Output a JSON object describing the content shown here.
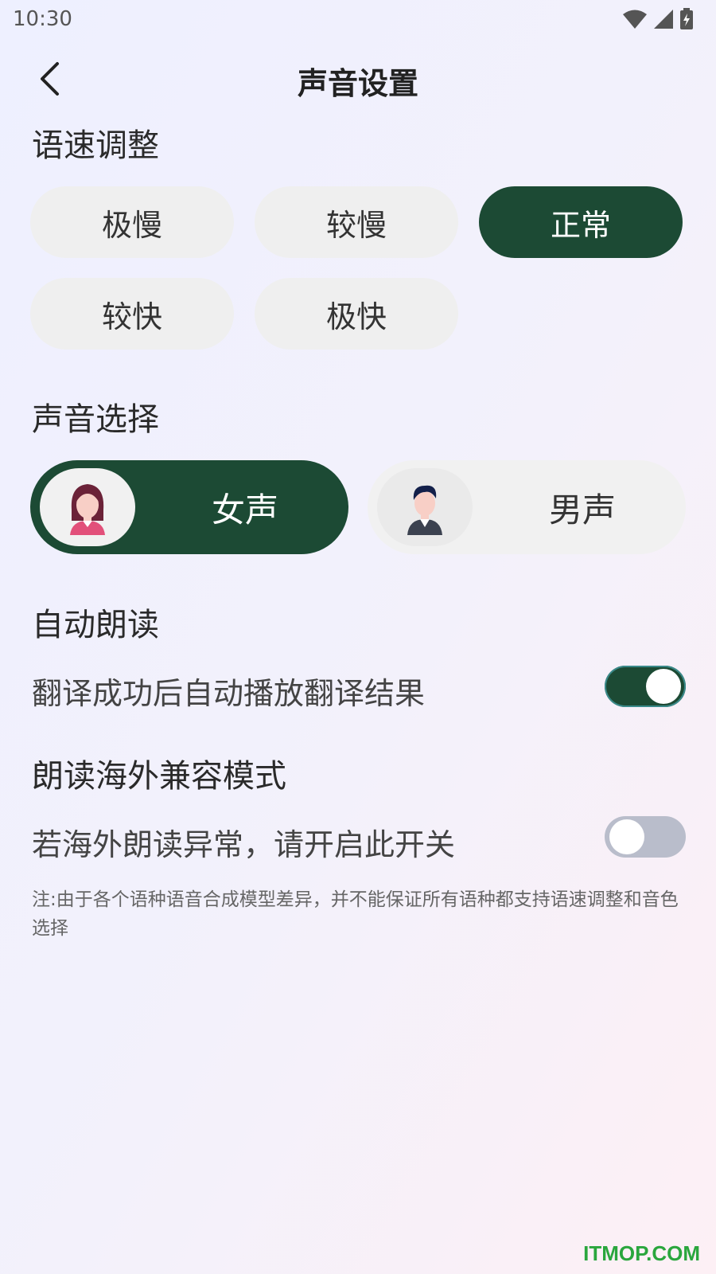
{
  "status_bar": {
    "time": "10:30"
  },
  "header": {
    "title": "声音设置"
  },
  "speed": {
    "title": "语速调整",
    "options": [
      {
        "label": "极慢",
        "selected": false
      },
      {
        "label": "较慢",
        "selected": false
      },
      {
        "label": "正常",
        "selected": true
      },
      {
        "label": "较快",
        "selected": false
      },
      {
        "label": "极快",
        "selected": false
      }
    ]
  },
  "voice": {
    "title": "声音选择",
    "options": [
      {
        "label": "女声",
        "selected": true
      },
      {
        "label": "男声",
        "selected": false
      }
    ]
  },
  "auto_read": {
    "title": "自动朗读",
    "description": "翻译成功后自动播放翻译结果",
    "enabled": true
  },
  "compat_mode": {
    "title": "朗读海外兼容模式",
    "description": "若海外朗读异常，请开启此开关",
    "enabled": false
  },
  "note": "注:由于各个语种语音合成模型差异，并不能保证所有语种都支持语速调整和音色选择",
  "watermark": "ITMOP.COM",
  "colors": {
    "accent": "#1c4a34",
    "toggle_off": "#b9bdcb",
    "button_bg": "#efefef"
  },
  "icons": [
    "wifi-icon",
    "signal-icon",
    "battery-icon",
    "back-arrow-icon",
    "female-avatar-icon",
    "male-avatar-icon"
  ]
}
